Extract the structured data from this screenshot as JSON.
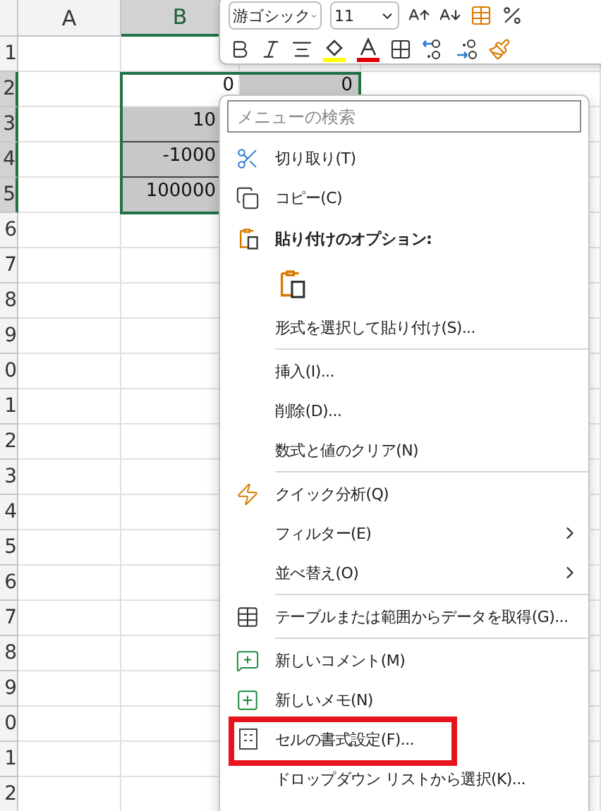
{
  "sheet": {
    "columns": [
      {
        "label": "A",
        "selected": false
      },
      {
        "label": "B",
        "selected": true
      }
    ],
    "rows": [
      {
        "label": "1",
        "selected": false
      },
      {
        "label": "2",
        "selected": true,
        "b": {
          "text": "0",
          "shaded": false
        },
        "c": {
          "text": "0",
          "shaded": true
        }
      },
      {
        "label": "3",
        "selected": true,
        "b": {
          "text": "10",
          "shaded": true
        }
      },
      {
        "label": "4",
        "selected": true,
        "b": {
          "text": "-1000",
          "shaded": true
        }
      },
      {
        "label": "5",
        "selected": true,
        "b": {
          "text": "100000",
          "shaded": true
        }
      },
      {
        "label": "6",
        "selected": false
      },
      {
        "label": "7",
        "selected": false
      },
      {
        "label": "8",
        "selected": false
      },
      {
        "label": "9",
        "selected": false
      },
      {
        "label": "0",
        "selected": false
      },
      {
        "label": "1",
        "selected": false
      },
      {
        "label": "2",
        "selected": false
      },
      {
        "label": "3",
        "selected": false
      },
      {
        "label": "4",
        "selected": false
      },
      {
        "label": "5",
        "selected": false
      },
      {
        "label": "6",
        "selected": false
      },
      {
        "label": "7",
        "selected": false
      },
      {
        "label": "8",
        "selected": false
      },
      {
        "label": "9",
        "selected": false
      },
      {
        "label": "0",
        "selected": false
      },
      {
        "label": "1",
        "selected": false
      },
      {
        "label": "2",
        "selected": false
      }
    ]
  },
  "mini_toolbar": {
    "font": "游ゴシック",
    "size": "11"
  },
  "context_menu": {
    "search": {
      "placeholder": "メニューの検索"
    },
    "items": [
      {
        "kind": "cut",
        "text": "切り取り(T)"
      },
      {
        "kind": "copy",
        "text": "コピー(C)"
      },
      {
        "kind": "header",
        "text": "貼り付けのオプション:"
      },
      {
        "kind": "paste-options"
      },
      {
        "kind": "plain",
        "text": "形式を選択して貼り付け(S)..."
      },
      {
        "kind": "separator"
      },
      {
        "kind": "plain",
        "text": "挿入(I)..."
      },
      {
        "kind": "plain",
        "text": "削除(D)..."
      },
      {
        "kind": "plain",
        "text": "数式と値のクリア(N)"
      },
      {
        "kind": "separator"
      },
      {
        "kind": "quick",
        "text": "クイック分析(Q)"
      },
      {
        "kind": "plain",
        "text": "フィルター(E)",
        "submenu": true
      },
      {
        "kind": "plain",
        "text": "並べ替え(O)",
        "submenu": true
      },
      {
        "kind": "separator"
      },
      {
        "kind": "table",
        "text": "テーブルまたは範囲からデータを取得(G)..."
      },
      {
        "kind": "separator"
      },
      {
        "kind": "comment",
        "text": "新しいコメント(M)"
      },
      {
        "kind": "note",
        "text": "新しいメモ(N)"
      },
      {
        "kind": "format",
        "text": "セルの書式設定(F)...",
        "outlined": true
      },
      {
        "kind": "plain",
        "text": "ドロップダウン リストから選択(K)..."
      }
    ]
  }
}
